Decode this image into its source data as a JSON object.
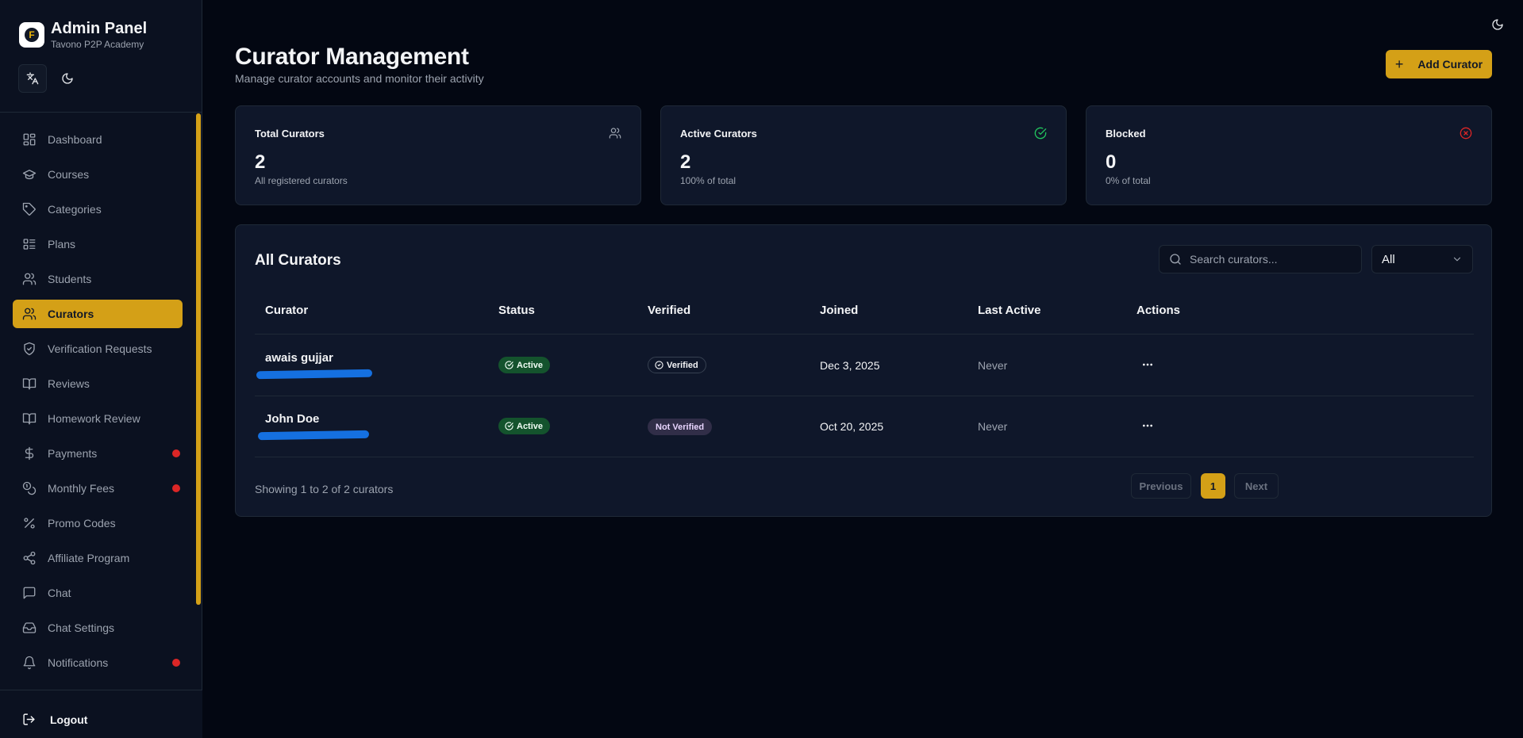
{
  "app": {
    "title": "Admin Panel",
    "subtitle": "Tavono P2P Academy",
    "logo_letter": "F"
  },
  "sidebar": {
    "items": [
      {
        "label": "Dashboard",
        "icon": "dashboard-icon"
      },
      {
        "label": "Courses",
        "icon": "graduation-cap-icon"
      },
      {
        "label": "Categories",
        "icon": "tag-icon"
      },
      {
        "label": "Plans",
        "icon": "list-icon"
      },
      {
        "label": "Students",
        "icon": "users-icon"
      },
      {
        "label": "Curators",
        "icon": "users-icon",
        "active": true
      },
      {
        "label": "Verification Requests",
        "icon": "shield-check-icon"
      },
      {
        "label": "Reviews",
        "icon": "book-open-icon"
      },
      {
        "label": "Homework Review",
        "icon": "book-open-icon"
      },
      {
        "label": "Payments",
        "icon": "dollar-icon",
        "dot": true
      },
      {
        "label": "Monthly Fees",
        "icon": "coins-icon",
        "dot": true
      },
      {
        "label": "Promo Codes",
        "icon": "percent-icon"
      },
      {
        "label": "Affiliate Program",
        "icon": "share-icon"
      },
      {
        "label": "Chat",
        "icon": "chat-icon"
      },
      {
        "label": "Chat Settings",
        "icon": "inbox-icon"
      },
      {
        "label": "Notifications",
        "icon": "bell-icon",
        "dot": true
      }
    ],
    "logout_label": "Logout"
  },
  "page": {
    "title": "Curator Management",
    "subtitle": "Manage curator accounts and monitor their activity",
    "add_button_label": "Add Curator"
  },
  "stats": [
    {
      "label": "Total Curators",
      "value": "2",
      "note": "All registered curators",
      "icon": "users-icon",
      "color": "#9ca3af"
    },
    {
      "label": "Active Curators",
      "value": "2",
      "note": "100% of total",
      "icon": "check-circle-icon",
      "color": "#22c55e"
    },
    {
      "label": "Blocked",
      "value": "0",
      "note": "0% of total",
      "icon": "x-circle-icon",
      "color": "#dc2626"
    }
  ],
  "table": {
    "title": "All Curators",
    "search_placeholder": "Search curators...",
    "filter_value": "All",
    "columns": [
      "Curator",
      "Status",
      "Verified",
      "Joined",
      "Last Active",
      "Actions"
    ],
    "rows": [
      {
        "name": "awais gujjar",
        "status": "Active",
        "verified": "Verified",
        "is_verified": true,
        "joined": "Dec 3, 2025",
        "last_active": "Never"
      },
      {
        "name": "John Doe",
        "status": "Active",
        "verified": "Not Verified",
        "is_verified": false,
        "joined": "Oct 20, 2025",
        "last_active": "Never"
      }
    ],
    "showing_text": "Showing 1 to 2 of 2 curators",
    "pagination": {
      "previous": "Previous",
      "current": "1",
      "next": "Next"
    }
  },
  "colors": {
    "accent": "#d4a017",
    "background": "#030712",
    "card": "#0f172a",
    "success": "#14532d",
    "danger": "#dc2626"
  }
}
